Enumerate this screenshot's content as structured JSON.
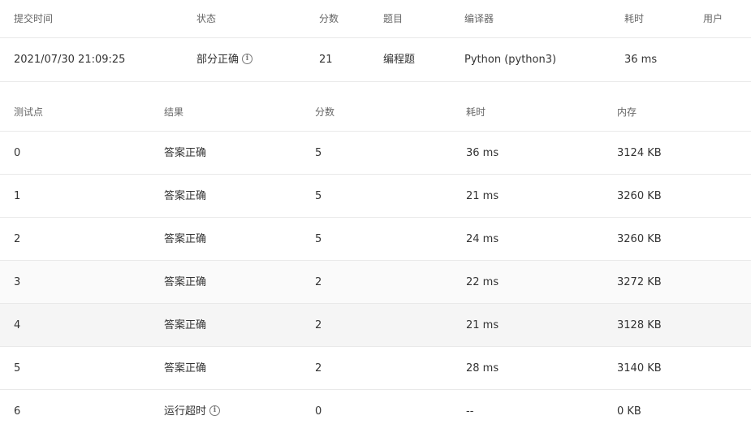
{
  "submission_header": {
    "time": "提交时间",
    "status": "状态",
    "score": "分数",
    "problem": "题目",
    "compiler": "编译器",
    "runtime": "耗时",
    "user": "用户"
  },
  "submission": {
    "time": "2021/07/30 21:09:25",
    "status": "部分正确",
    "score": "21",
    "problem": "编程题",
    "compiler": "Python (python3)",
    "runtime": "36 ms",
    "user": ""
  },
  "testcase_header": {
    "id": "测试点",
    "result": "结果",
    "score": "分数",
    "runtime": "耗时",
    "memory": "内存"
  },
  "testcases": [
    {
      "id": "0",
      "result": "答案正确",
      "score": "5",
      "runtime": "36 ms",
      "memory": "3124 KB"
    },
    {
      "id": "1",
      "result": "答案正确",
      "score": "5",
      "runtime": "21 ms",
      "memory": "3260 KB"
    },
    {
      "id": "2",
      "result": "答案正确",
      "score": "5",
      "runtime": "24 ms",
      "memory": "3260 KB"
    },
    {
      "id": "3",
      "result": "答案正确",
      "score": "2",
      "runtime": "22 ms",
      "memory": "3272 KB"
    },
    {
      "id": "4",
      "result": "答案正确",
      "score": "2",
      "runtime": "21 ms",
      "memory": "3128 KB"
    },
    {
      "id": "5",
      "result": "答案正确",
      "score": "2",
      "runtime": "28 ms",
      "memory": "3140 KB"
    },
    {
      "id": "6",
      "result": "运行超时",
      "score": "0",
      "runtime": "--",
      "memory": "0 KB"
    }
  ],
  "colors": {
    "accepted": "#ed3f14",
    "partial": "#19be6b",
    "timeout": "#19be6b"
  },
  "icons": {
    "info": "info-circle-icon"
  }
}
